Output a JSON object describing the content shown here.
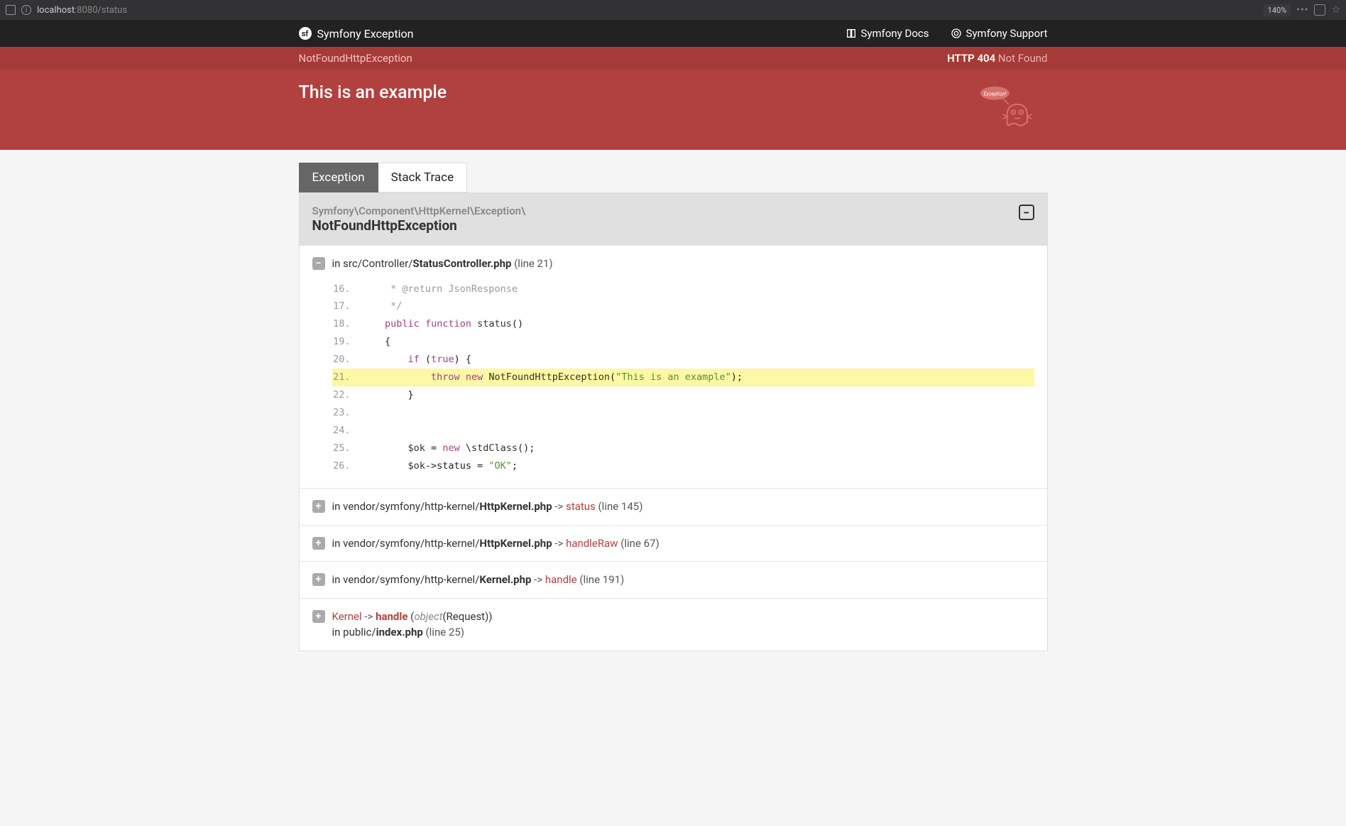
{
  "browser": {
    "url_host": "localhost",
    "url_port": ":8080",
    "url_path": "/status",
    "zoom": "140%"
  },
  "nav": {
    "brand": "Symfony Exception",
    "docs_label": "Symfony Docs",
    "support_label": "Symfony Support"
  },
  "error": {
    "exception_class": "NotFoundHttpException",
    "http_code": "HTTP 404",
    "http_text": "Not Found",
    "title": "This is an example",
    "ghost_bubble": "Exception!"
  },
  "tabs": {
    "exception": "Exception",
    "stack_trace": "Stack Trace"
  },
  "panel": {
    "namespace": "Symfony\\Component\\HttpKernel\\Exception\\",
    "class_name": "NotFoundHttpException"
  },
  "trace": {
    "items": [
      {
        "prefix": "in ",
        "path": "src/Controller/",
        "file": "StatusController.php",
        "line_label": " (line 21)",
        "expanded": true
      },
      {
        "prefix": "in ",
        "path": "vendor/symfony/http-kernel/",
        "file": "HttpKernel.php",
        "arrow": " -> ",
        "method": "status",
        "line_label": " (line 145)"
      },
      {
        "prefix": "in ",
        "path": "vendor/symfony/http-kernel/",
        "file": "HttpKernel.php",
        "arrow": " -> ",
        "method": "handleRaw",
        "line_label": " (line 67)"
      },
      {
        "prefix": "in ",
        "path": "vendor/symfony/http-kernel/",
        "file": "Kernel.php",
        "arrow": " -> ",
        "method": "handle",
        "line_label": " (line 191)"
      },
      {
        "class_link": "Kernel",
        "arrow": " -> ",
        "method": "handle",
        "args_open": " (",
        "args_type": "object",
        "args_rest": "(Request))",
        "second_line_prefix": "in ",
        "second_path": "public/",
        "second_file": "index.php",
        "second_line_label": " (line 25)"
      }
    ]
  },
  "code": {
    "lines": [
      {
        "n": "16.",
        "html": "     <span class='kw-comment'>* @return JsonResponse</span>"
      },
      {
        "n": "17.",
        "html": "     <span class='kw-comment'>*/</span>"
      },
      {
        "n": "18.",
        "html": "    <span class='kw-keyword'>public</span> <span class='kw-keyword'>function</span> <span class='kw-def'>status</span>()"
      },
      {
        "n": "19.",
        "html": "    {"
      },
      {
        "n": "20.",
        "html": "        <span class='kw-keyword'>if</span> (<span class='kw-keyword'>true</span>) {"
      },
      {
        "n": "21.",
        "hl": true,
        "html": "            <span class='kw-keyword'>throw</span> <span class='kw-keyword'>new</span> <span class='kw-cls'>NotFoundHttpException</span>(<span class='kw-str'>\"This is an example\"</span>);"
      },
      {
        "n": "22.",
        "html": "        }"
      },
      {
        "n": "23.",
        "html": ""
      },
      {
        "n": "24.",
        "html": ""
      },
      {
        "n": "25.",
        "html": "        <span class='kw-var'>$ok</span> = <span class='kw-keyword'>new</span> \\<span class='kw-cls'>stdClass</span>();"
      },
      {
        "n": "26.",
        "html": "        <span class='kw-var'>$ok</span>->status = <span class='kw-str'>\"OK\"</span>;"
      }
    ]
  }
}
